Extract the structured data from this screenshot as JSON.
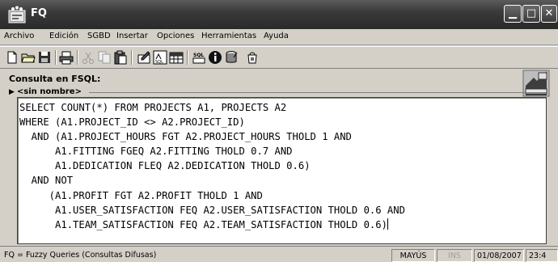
{
  "window": {
    "title": "FQ",
    "icon": "app-snow-icon",
    "controls": [
      "minimize-icon",
      "maximize-icon",
      "close-icon"
    ]
  },
  "menu": [
    {
      "label": "Archivo"
    },
    {
      "label": "Edición"
    },
    {
      "label": "SGBD"
    },
    {
      "label": "Insertar"
    },
    {
      "label": "Opciones"
    },
    {
      "label": "Herramientas"
    },
    {
      "label": "Ayuda"
    }
  ],
  "toolbar": {
    "icons": [
      "new-document-icon",
      "open-folder-icon",
      "save-disk-icon",
      "print-icon",
      "cut-icon",
      "copy-icon",
      "paste-icon",
      "edit-query-icon",
      "sql-icon",
      "table-icon",
      "sql-script-icon",
      "info-icon",
      "database-icon",
      "run-icon"
    ]
  },
  "query": {
    "label": "Consulta en FSQL:",
    "tab": "<sin nombre>",
    "text": "SELECT COUNT(*) FROM PROJECTS A1, PROJECTS A2\nWHERE (A1.PROJECT_ID <> A2.PROJECT_ID)\n  AND (A1.PROJECT_HOURS FGT A2.PROJECT_HOURS THOLD 1 AND\n      A1.FITTING FGEQ A2.FITTING THOLD 0.7 AND\n      A1.DEDICATION FLEQ A2.DEDICATION THOLD 0.6)\n  AND NOT\n     (A1.PROFIT FGT A2.PROFIT THOLD 1 AND\n      A1.USER_SATISFACTION FEQ A2.USER_SATISFACTION THOLD 0.6 AND\n      A1.TEAM_SATISFACTION FEQ A2.TEAM_SATISFACTION THOLD 0.6)"
  },
  "status": {
    "main": "FQ = Fuzzy Queries (Consultas Difusas)",
    "mayus": "MAYÚS",
    "ins": "INS",
    "date": "01/08/2007",
    "time": "23:4"
  },
  "colors": {
    "titlebar": "#3a3a3a",
    "chrome": "#d4d0c8",
    "editor_bg": "#ffffff"
  }
}
